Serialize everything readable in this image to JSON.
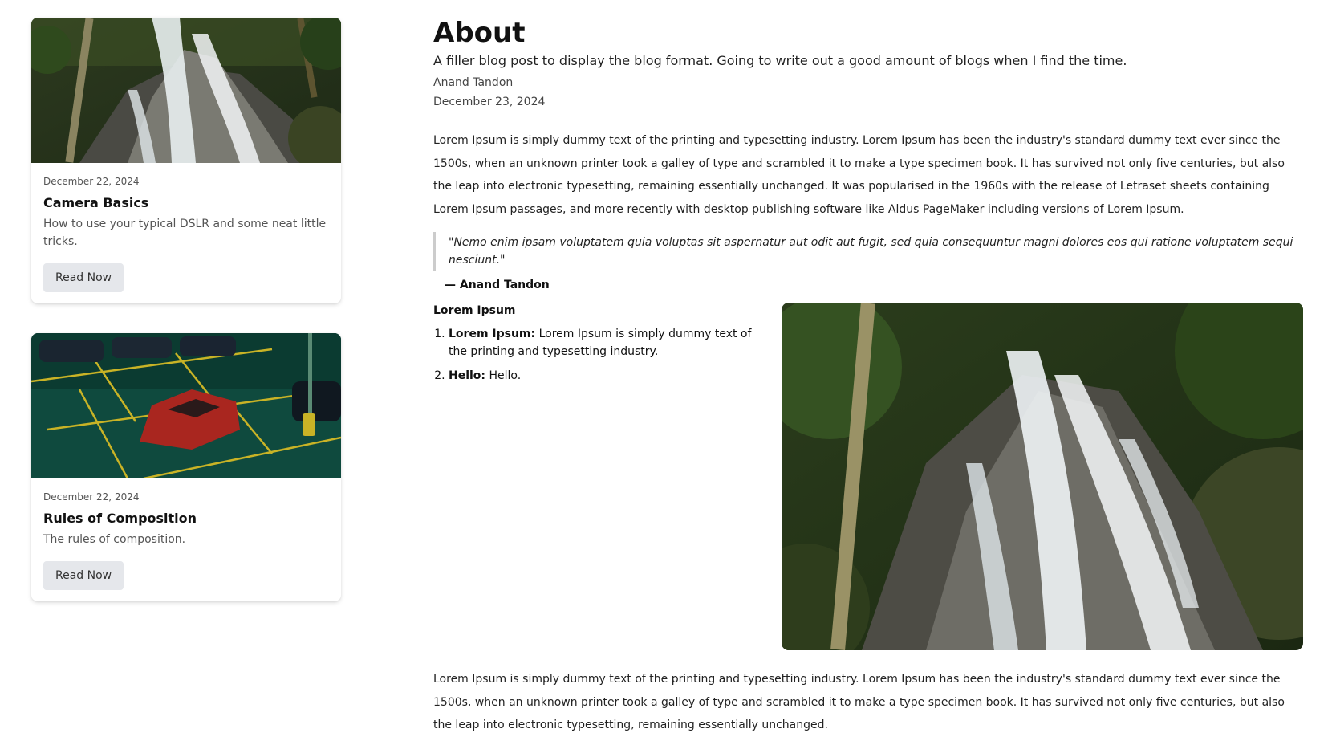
{
  "sidebar": {
    "cards": [
      {
        "date": "December 22, 2024",
        "title": "Camera Basics",
        "description": "How to use your typical DSLR and some neat little tricks.",
        "button": "Read Now",
        "image": "waterfall-photo"
      },
      {
        "date": "December 22, 2024",
        "title": "Rules of Composition",
        "description": "The rules of composition.",
        "button": "Read Now",
        "image": "parking-lot-red-car-photo"
      }
    ]
  },
  "post": {
    "title": "About",
    "subtitle": "A filler blog post to display the blog format. Going to write out a good amount of blogs when I find the time.",
    "author": "Anand Tandon",
    "date": "December 23, 2024",
    "paragraph1": "Lorem Ipsum is simply dummy text of the printing and typesetting industry. Lorem Ipsum has been the industry's standard dummy text ever since the 1500s, when an unknown printer took a galley of type and scrambled it to make a type specimen book. It has survived not only five centuries, but also the leap into electronic typesetting, remaining essentially unchanged. It was popularised in the 1960s with the release of Letraset sheets containing Lorem Ipsum passages, and more recently with desktop publishing software like Aldus PageMaker including versions of Lorem Ipsum.",
    "quote": "\"Nemo enim ipsam voluptatem quia voluptas sit aspernatur aut odit aut fugit, sed quia consequuntur magni dolores eos qui ratione voluptatem sequi nesciunt.\"",
    "quote_author": "— Anand Tandon",
    "list_heading": "Lorem Ipsum",
    "list": [
      {
        "term": "Lorem Ipsum:",
        "text": " Lorem Ipsum is simply dummy text of the printing and typesetting industry."
      },
      {
        "term": "Hello:",
        "text": " Hello."
      }
    ],
    "feature_image": "waterfall-photo",
    "paragraph2": "Lorem Ipsum is simply dummy text of the printing and typesetting industry. Lorem Ipsum has been the industry's standard dummy text ever since the 1500s, when an unknown printer took a galley of type and scrambled it to make a type specimen book. It has survived not only five centuries, but also the leap into electronic typesetting, remaining essentially unchanged."
  }
}
